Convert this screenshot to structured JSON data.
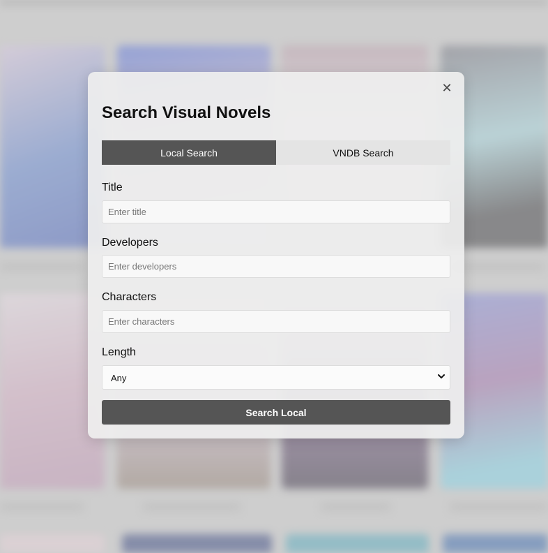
{
  "modal": {
    "title": "Search Visual Novels",
    "close_icon": "close-icon",
    "close_glyph": "✕"
  },
  "tabs": [
    {
      "label": "Local Search",
      "active": true
    },
    {
      "label": "VNDB Search",
      "active": false
    }
  ],
  "form": {
    "title": {
      "label": "Title",
      "placeholder": "Enter title",
      "value": ""
    },
    "developers": {
      "label": "Developers",
      "placeholder": "Enter developers",
      "value": ""
    },
    "characters": {
      "label": "Characters",
      "placeholder": "Enter characters",
      "value": ""
    },
    "length": {
      "label": "Length",
      "selected": "Any",
      "icon": "chevron-down-icon"
    }
  },
  "actions": {
    "search_label": "Search Local"
  },
  "colors": {
    "accent": "#555555",
    "modal_bg": "#eeeeee",
    "backdrop": "#c9c9c9"
  }
}
